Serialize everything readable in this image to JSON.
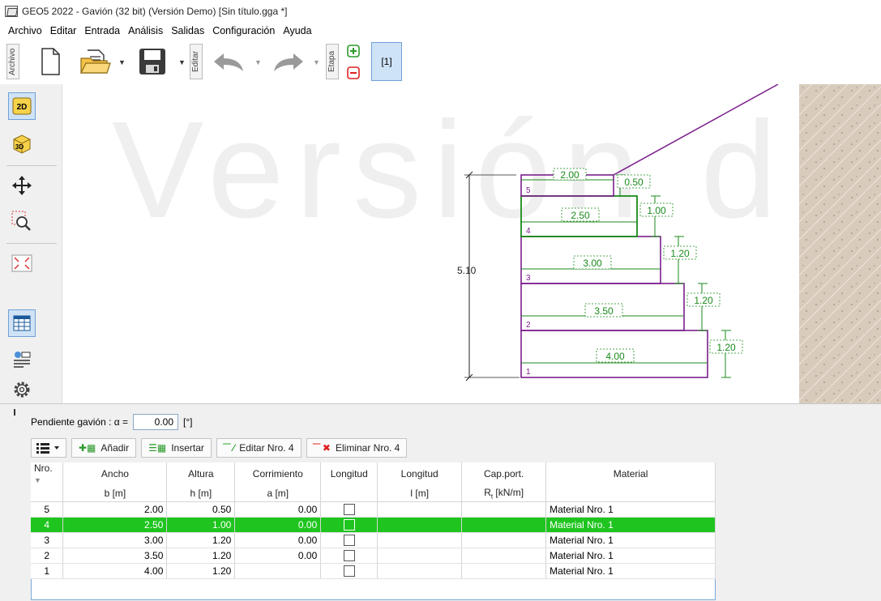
{
  "window": {
    "title": "GEO5 2022 - Gavión (32 bit) (Versión Demo) [Sin título.gga *]"
  },
  "menu": [
    "Archivo",
    "Editar",
    "Entrada",
    "Análisis",
    "Salidas",
    "Configuración",
    "Ayuda"
  ],
  "toolbar": {
    "archivo_label": "Archivo",
    "editar_label": "Editar",
    "etapa_label": "Etapa",
    "stage_button": "[1]"
  },
  "left_toolbar": {
    "btn_2d": "2D",
    "btn_3d": "3D"
  },
  "canvas": {
    "watermark": "Versión d",
    "total_height_label": "5.10",
    "blocks": [
      {
        "nr": "5",
        "width_label": "2.00",
        "height_label": "0.50"
      },
      {
        "nr": "4",
        "width_label": "2.50",
        "height_label": "1.00"
      },
      {
        "nr": "3",
        "width_label": "3.00",
        "height_label": "1.20"
      },
      {
        "nr": "2",
        "width_label": "3.50",
        "height_label": "1.20"
      },
      {
        "nr": "1",
        "width_label": "4.00",
        "height_label": "1.20"
      }
    ]
  },
  "panel": {
    "slope_label": "Pendiente gavión : α =",
    "slope_value": "0.00",
    "slope_unit": "[°]",
    "btn_add": "Añadir",
    "btn_insert": "Insertar",
    "btn_edit": "Editar Nro. 4",
    "btn_delete": "Eliminar Nro. 4"
  },
  "table": {
    "headers": [
      {
        "top": "Nro.",
        "bottom": ""
      },
      {
        "top": "Ancho",
        "bottom": "b [m]"
      },
      {
        "top": "Altura",
        "bottom": "h [m]"
      },
      {
        "top": "Corrimiento",
        "bottom": "a [m]"
      },
      {
        "top": "Longitud",
        "bottom": ""
      },
      {
        "top": "Longitud",
        "bottom": "l [m]"
      },
      {
        "top": "Cap.port.",
        "bottom": "Rt [kN/m]"
      },
      {
        "top": "Material",
        "bottom": ""
      }
    ],
    "rows": [
      {
        "nr": "5",
        "b": "2.00",
        "h": "0.50",
        "a": "0.00",
        "material": "Material Nro. 1",
        "selected": false
      },
      {
        "nr": "4",
        "b": "2.50",
        "h": "1.00",
        "a": "0.00",
        "material": "Material Nro. 1",
        "selected": true
      },
      {
        "nr": "3",
        "b": "3.00",
        "h": "1.20",
        "a": "0.00",
        "material": "Material Nro. 1",
        "selected": false
      },
      {
        "nr": "2",
        "b": "3.50",
        "h": "1.20",
        "a": "0.00",
        "material": "Material Nro. 1",
        "selected": false
      },
      {
        "nr": "1",
        "b": "4.00",
        "h": "1.20",
        "a": "",
        "material": "Material Nro. 1",
        "selected": false
      }
    ]
  },
  "colors": {
    "accent_selected": "#1fc41f",
    "block_outline": "#7b1e8c",
    "dimension": "#1a8a1a",
    "soil": "#d8c9b8"
  }
}
